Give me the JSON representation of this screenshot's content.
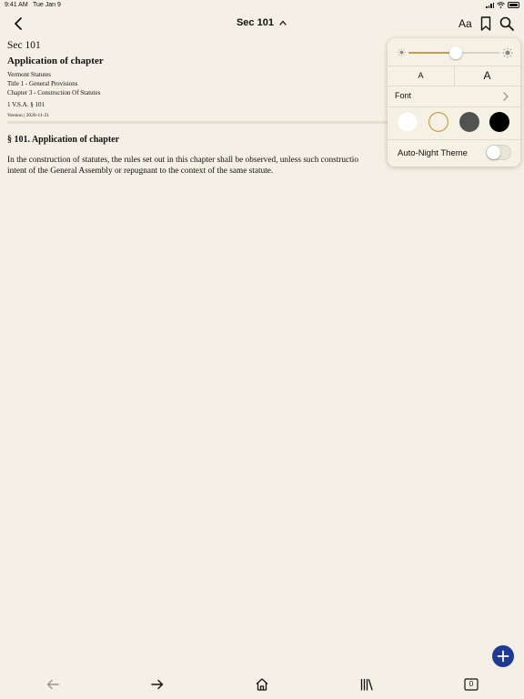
{
  "status_bar": {
    "time": "9:41 AM",
    "date": "Tue Jan 9"
  },
  "nav": {
    "title": "Sec 101",
    "text_settings_label": "Aa",
    "icons": [
      "back-chevron-icon",
      "chevron-up-icon",
      "bookmark-icon",
      "search-icon"
    ]
  },
  "document": {
    "section": "Sec 101",
    "title": "Application of chapter",
    "meta": [
      "Vermont Statutes",
      "Title 1 - General Provisions",
      "Chapter 3 - Construction Of Statutes"
    ],
    "citation": "1 V.S.A. § 101",
    "version": "Version | 2020-11-21",
    "heading": "§ 101. Application of chapter",
    "body_lines": [
      "In the construction of statutes, the rules set out in this chapter shall be observed, unless such constructio",
      "intent of the General Assembly or repugnant to the context of the same statute."
    ]
  },
  "text_settings": {
    "brightness": 0.52,
    "font_size_small": "A",
    "font_size_large": "A",
    "font_label": "Font",
    "themes": [
      {
        "name": "white",
        "color": "#ffffff"
      },
      {
        "name": "sepia",
        "color": "#f6f1e5",
        "selected": true
      },
      {
        "name": "gray",
        "color": "#525252"
      },
      {
        "name": "black",
        "color": "#000000"
      }
    ],
    "selected_theme_border": "#c3a144",
    "auto_night_label": "Auto-Night Theme",
    "auto_night_on": false
  },
  "fab": {
    "icon": "plus-icon",
    "color": "#1f3a93"
  },
  "toolbar": {
    "icons": [
      "back-arrow-icon",
      "forward-arrow-icon",
      "home-icon",
      "library-icon",
      "tabs-icon"
    ],
    "tabs_count": "0"
  }
}
